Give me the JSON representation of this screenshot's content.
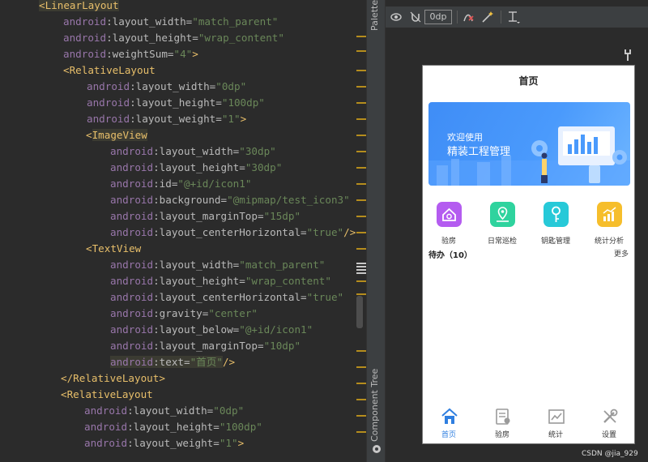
{
  "editor": {
    "lines": [
      {
        "parts": [
          {
            "t": "<LinearLayout",
            "c": "tag-hl"
          }
        ]
      },
      {
        "parts": [
          {
            "t": "android",
            "c": "ns"
          },
          {
            "t": ":layout_width=",
            "c": "attr"
          },
          {
            "t": "\"match_parent\"",
            "c": "val"
          }
        ]
      },
      {
        "parts": [
          {
            "t": "android",
            "c": "ns"
          },
          {
            "t": ":layout_height=",
            "c": "attr"
          },
          {
            "t": "\"wrap_content\"",
            "c": "val"
          }
        ]
      },
      {
        "parts": [
          {
            "t": "android",
            "c": "ns"
          },
          {
            "t": ":weightSum=",
            "c": "attr"
          },
          {
            "t": "\"4\"",
            "c": "val"
          },
          {
            "t": ">",
            "c": "punct"
          }
        ]
      },
      {
        "parts": [
          {
            "t": "<RelativeLayout",
            "c": "tag"
          }
        ]
      },
      {
        "parts": [
          {
            "t": "android",
            "c": "ns"
          },
          {
            "t": ":layout_width=",
            "c": "attr"
          },
          {
            "t": "\"0dp\"",
            "c": "val"
          }
        ]
      },
      {
        "parts": [
          {
            "t": "android",
            "c": "ns"
          },
          {
            "t": ":layout_height=",
            "c": "attr"
          },
          {
            "t": "\"100dp\"",
            "c": "val"
          }
        ]
      },
      {
        "parts": [
          {
            "t": "android",
            "c": "ns"
          },
          {
            "t": ":layout_weight=",
            "c": "attr"
          },
          {
            "t": "\"1\"",
            "c": "val"
          },
          {
            "t": ">",
            "c": "punct"
          }
        ]
      },
      {
        "parts": [
          {
            "t": "<",
            "c": "tag"
          },
          {
            "t": "ImageView",
            "c": "tag-hl"
          }
        ]
      },
      {
        "parts": [
          {
            "t": "android",
            "c": "ns"
          },
          {
            "t": ":layout_width=",
            "c": "attr"
          },
          {
            "t": "\"30dp\"",
            "c": "val"
          }
        ]
      },
      {
        "parts": [
          {
            "t": "android",
            "c": "ns"
          },
          {
            "t": ":layout_height=",
            "c": "attr"
          },
          {
            "t": "\"30dp\"",
            "c": "val"
          }
        ]
      },
      {
        "parts": [
          {
            "t": "android",
            "c": "ns"
          },
          {
            "t": ":id=",
            "c": "attr"
          },
          {
            "t": "\"@+id/icon1\"",
            "c": "val"
          }
        ]
      },
      {
        "parts": [
          {
            "t": "android",
            "c": "ns"
          },
          {
            "t": ":background=",
            "c": "attr"
          },
          {
            "t": "\"@mipmap/test_icon3\"",
            "c": "val"
          }
        ]
      },
      {
        "parts": [
          {
            "t": "android",
            "c": "ns"
          },
          {
            "t": ":layout_marginTop=",
            "c": "attr"
          },
          {
            "t": "\"15dp\"",
            "c": "val"
          }
        ]
      },
      {
        "parts": [
          {
            "t": "android",
            "c": "ns"
          },
          {
            "t": ":layout_centerHorizontal=",
            "c": "attr"
          },
          {
            "t": "\"true\"",
            "c": "val"
          },
          {
            "t": "/>",
            "c": "punct"
          }
        ]
      },
      {
        "parts": [
          {
            "t": "<TextView",
            "c": "tag"
          }
        ]
      },
      {
        "parts": [
          {
            "t": "android",
            "c": "ns"
          },
          {
            "t": ":layout_width=",
            "c": "attr"
          },
          {
            "t": "\"match_parent\"",
            "c": "val"
          }
        ]
      },
      {
        "parts": [
          {
            "t": "android",
            "c": "ns"
          },
          {
            "t": ":layout_height=",
            "c": "attr"
          },
          {
            "t": "\"wrap_content\"",
            "c": "val"
          }
        ]
      },
      {
        "parts": [
          {
            "t": "android",
            "c": "ns"
          },
          {
            "t": ":layout_centerHorizontal=",
            "c": "attr"
          },
          {
            "t": "\"true\"",
            "c": "val"
          }
        ]
      },
      {
        "parts": [
          {
            "t": "android",
            "c": "ns"
          },
          {
            "t": ":gravity=",
            "c": "attr"
          },
          {
            "t": "\"center\"",
            "c": "val"
          }
        ]
      },
      {
        "parts": [
          {
            "t": "android",
            "c": "ns"
          },
          {
            "t": ":layout_below=",
            "c": "attr"
          },
          {
            "t": "\"@+id/icon1\"",
            "c": "val"
          }
        ]
      },
      {
        "parts": [
          {
            "t": "android",
            "c": "ns"
          },
          {
            "t": ":layout_marginTop=",
            "c": "attr"
          },
          {
            "t": "\"10dp\"",
            "c": "val"
          }
        ]
      },
      {
        "parts": [
          {
            "t": "android",
            "c": "ns text-hl"
          },
          {
            "t": ":text=",
            "c": "attr text-hl"
          },
          {
            "t": "\"首页\"",
            "c": "val text-hl"
          },
          {
            "t": "/>",
            "c": "punct"
          }
        ]
      },
      {
        "parts": [
          {
            "t": "</RelativeLayout>",
            "c": "tag"
          }
        ]
      },
      {
        "parts": [
          {
            "t": "<RelativeLayout",
            "c": "tag"
          }
        ]
      },
      {
        "parts": [
          {
            "t": "android",
            "c": "ns"
          },
          {
            "t": ":layout_width=",
            "c": "attr"
          },
          {
            "t": "\"0dp\"",
            "c": "val"
          }
        ]
      },
      {
        "parts": [
          {
            "t": "android",
            "c": "ns"
          },
          {
            "t": ":layout_height=",
            "c": "attr"
          },
          {
            "t": "\"100dp\"",
            "c": "val"
          }
        ]
      },
      {
        "parts": [
          {
            "t": "android",
            "c": "ns"
          },
          {
            "t": ":layout_weight=",
            "c": "attr"
          },
          {
            "t": "\"1\"",
            "c": "val"
          },
          {
            "t": ">",
            "c": "punct"
          }
        ]
      }
    ]
  },
  "side_strip": {
    "palette_label": "Palette",
    "tree_label": "Component Tree"
  },
  "toolbar": {
    "dp_value": "0dp"
  },
  "phone": {
    "title": "首页",
    "banner": {
      "line1": "欢迎使用",
      "line2": "精装工程管理"
    },
    "functions": [
      {
        "label": "验房",
        "color": "#b45cf0",
        "icon": "house-icon"
      },
      {
        "label": "日常巡检",
        "color": "#2fd39e",
        "icon": "inspection-icon"
      },
      {
        "label": "钥匙管理",
        "color": "#27c9d8",
        "icon": "key-icon"
      },
      {
        "label": "统计分析",
        "color": "#f6be2c",
        "icon": "chart-icon"
      }
    ],
    "todo": {
      "title": "待办（10）",
      "more": "更多"
    },
    "nav": [
      {
        "label": "首页",
        "icon": "home-icon",
        "active": true
      },
      {
        "label": "验房",
        "icon": "inspect-icon",
        "active": false
      },
      {
        "label": "统计",
        "icon": "stats-icon",
        "active": false
      },
      {
        "label": "设置",
        "icon": "settings-icon",
        "active": false
      }
    ]
  },
  "watermark": "CSDN @jia_929"
}
